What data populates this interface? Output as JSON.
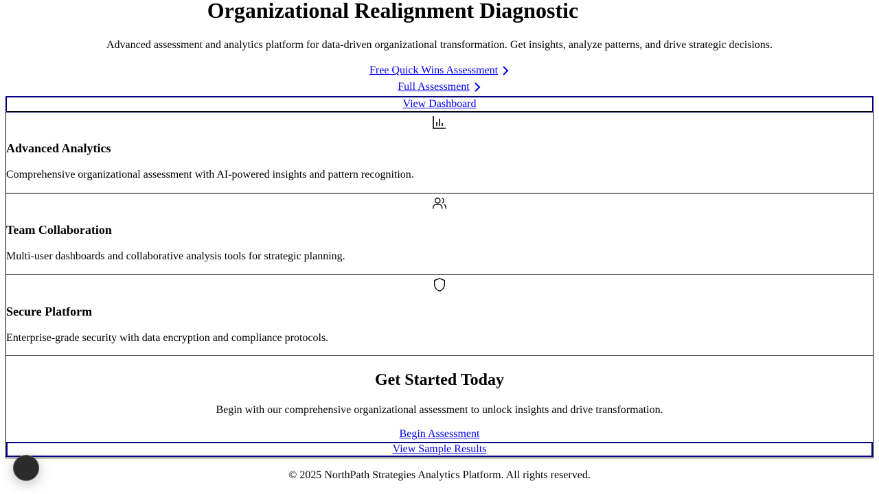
{
  "hero": {
    "title": "Organizational Realignment Diagnostic",
    "subtitle": "Advanced assessment and analytics platform for data-driven organizational transformation. Get insights, analyze patterns, and drive strategic decisions."
  },
  "actions": {
    "quick_wins": "Free Quick Wins Assessment",
    "full": "Full Assessment",
    "dashboard": "View Dashboard"
  },
  "features": [
    {
      "icon": "bar-chart-icon",
      "title": "Advanced Analytics",
      "description": "Comprehensive organizational assessment with AI-powered insights and pattern recognition."
    },
    {
      "icon": "users-icon",
      "title": "Team Collaboration",
      "description": "Multi-user dashboards and collaborative analysis tools for strategic planning."
    },
    {
      "icon": "shield-icon",
      "title": "Secure Platform",
      "description": "Enterprise-grade security with data encryption and compliance protocols."
    }
  ],
  "cta": {
    "title": "Get Started Today",
    "text": "Begin with our comprehensive organizational assessment to unlock insights and drive transformation.",
    "begin": "Begin Assessment",
    "sample": "View Sample Results"
  },
  "footer": {
    "copyright": "© 2025 NorthPath Strategies Analytics Platform. All rights reserved."
  },
  "colors": {
    "link": "#0000ee",
    "button_border": "#000080"
  }
}
